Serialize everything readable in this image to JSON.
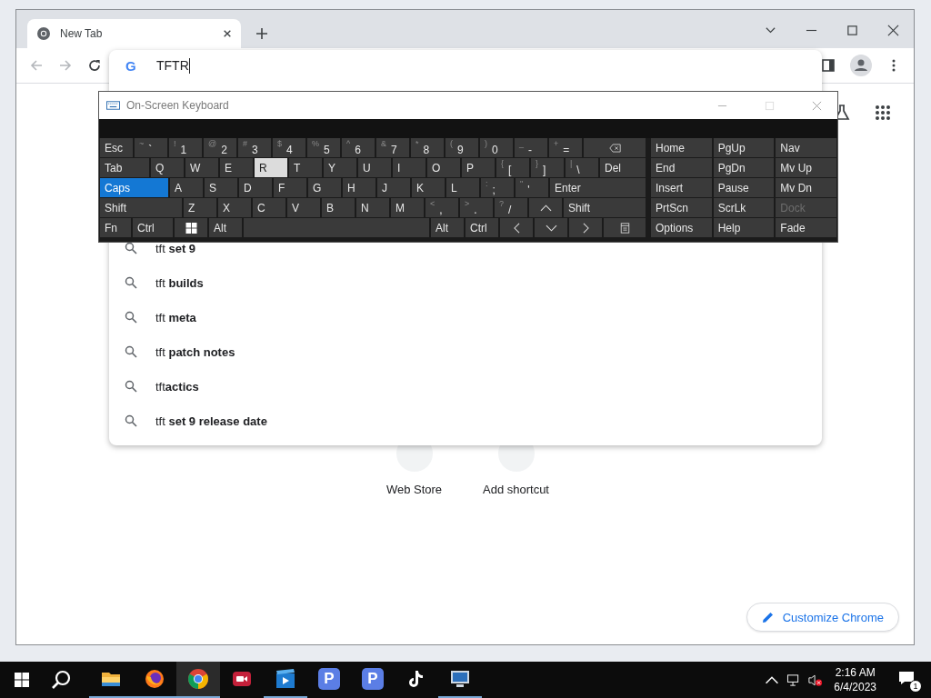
{
  "browser": {
    "tab": {
      "title": "New Tab"
    },
    "nav": {
      "back_disabled": true,
      "forward_disabled": true
    },
    "omnibox": {
      "engine_mark": "G",
      "value": "TFTR"
    },
    "suggestions": [
      {
        "text": "tft **set 9**"
      },
      {
        "text": "tft **builds**"
      },
      {
        "text": "tft **meta**"
      },
      {
        "text": "tft **patch notes**"
      },
      {
        "text": "tft**actics**"
      },
      {
        "text": "tft **set 9 release date**"
      }
    ],
    "shortcuts": [
      {
        "label": "Web Store"
      },
      {
        "label": "Add shortcut"
      }
    ],
    "customize_button": "Customize Chrome"
  },
  "keyboard": {
    "title": "On-Screen Keyboard",
    "rows": [
      {
        "keys": [
          {
            "label": "Esc"
          },
          {
            "label": "`",
            "shift": "~"
          },
          {
            "label": "1",
            "shift": "!"
          },
          {
            "label": "2",
            "shift": "@"
          },
          {
            "label": "3",
            "shift": "#"
          },
          {
            "label": "4",
            "shift": "$"
          },
          {
            "label": "5",
            "shift": "%"
          },
          {
            "label": "6",
            "shift": "^"
          },
          {
            "label": "7",
            "shift": "&"
          },
          {
            "label": "8",
            "shift": "*"
          },
          {
            "label": "9",
            "shift": "("
          },
          {
            "label": "0",
            "shift": ")"
          },
          {
            "label": "-",
            "shift": "_"
          },
          {
            "label": "=",
            "shift": "+"
          },
          {
            "kind": "backspace"
          }
        ]
      },
      {
        "keys": [
          {
            "label": "Tab"
          },
          {
            "label": "Q"
          },
          {
            "label": "W"
          },
          {
            "label": "E"
          },
          {
            "label": "R",
            "hovered": true
          },
          {
            "label": "T"
          },
          {
            "label": "Y"
          },
          {
            "label": "U"
          },
          {
            "label": "I"
          },
          {
            "label": "O"
          },
          {
            "label": "P"
          },
          {
            "label": "[",
            "shift": "{"
          },
          {
            "label": "]",
            "shift": "}"
          },
          {
            "label": "\\",
            "shift": "|"
          },
          {
            "label": "Del"
          }
        ]
      },
      {
        "keys": [
          {
            "label": "Caps",
            "on": true
          },
          {
            "label": "A"
          },
          {
            "label": "S"
          },
          {
            "label": "D"
          },
          {
            "label": "F"
          },
          {
            "label": "G"
          },
          {
            "label": "H"
          },
          {
            "label": "J"
          },
          {
            "label": "K"
          },
          {
            "label": "L"
          },
          {
            "label": ";",
            "shift": ":"
          },
          {
            "label": "'",
            "shift": "\""
          },
          {
            "label": "Enter"
          }
        ]
      },
      {
        "keys": [
          {
            "label": "Shift"
          },
          {
            "label": "Z"
          },
          {
            "label": "X"
          },
          {
            "label": "C"
          },
          {
            "label": "V"
          },
          {
            "label": "B"
          },
          {
            "label": "N"
          },
          {
            "label": "M"
          },
          {
            "label": ",",
            "shift": "<"
          },
          {
            "label": ".",
            "shift": ">"
          },
          {
            "label": "/",
            "shift": "?"
          },
          {
            "kind": "up"
          },
          {
            "label": "Shift"
          }
        ]
      },
      {
        "keys": [
          {
            "label": "Fn"
          },
          {
            "label": "Ctrl"
          },
          {
            "kind": "windows"
          },
          {
            "label": "Alt"
          },
          {
            "kind": "space"
          },
          {
            "label": "Alt"
          },
          {
            "label": "Ctrl"
          },
          {
            "kind": "left"
          },
          {
            "kind": "down"
          },
          {
            "kind": "right"
          },
          {
            "kind": "menu"
          }
        ]
      }
    ],
    "side_rows": [
      {
        "keys": [
          {
            "label": "Home"
          },
          {
            "label": "PgUp"
          },
          {
            "label": "Nav"
          }
        ]
      },
      {
        "keys": [
          {
            "label": "End"
          },
          {
            "label": "PgDn"
          },
          {
            "label": "Mv Up"
          }
        ]
      },
      {
        "keys": [
          {
            "label": "Insert"
          },
          {
            "label": "Pause"
          },
          {
            "label": "Mv Dn"
          }
        ]
      },
      {
        "keys": [
          {
            "label": "PrtScn"
          },
          {
            "label": "ScrLk"
          },
          {
            "label": "Dock",
            "disabled": true
          }
        ]
      },
      {
        "keys": [
          {
            "label": "Options"
          },
          {
            "label": "Help"
          },
          {
            "label": "Fade"
          }
        ]
      }
    ]
  },
  "taskbar": {
    "apps": [
      {
        "kind": "folder",
        "running": true,
        "selected": false
      },
      {
        "kind": "fox",
        "running": true,
        "selected": false
      },
      {
        "kind": "wheel",
        "running": true,
        "selected": true
      },
      {
        "kind": "camera",
        "running": false,
        "selected": false
      },
      {
        "kind": "clapper",
        "running": true,
        "selected": false
      },
      {
        "kind": "letter",
        "glyph": "P",
        "running": false,
        "selected": false
      },
      {
        "kind": "letter",
        "glyph": "P",
        "running": false,
        "selected": false
      },
      {
        "kind": "note",
        "running": false,
        "selected": false
      },
      {
        "kind": "monitor",
        "running": true,
        "selected": false
      }
    ],
    "time": "2:16 AM",
    "date": "6/4/2023",
    "notification_count": "1"
  }
}
